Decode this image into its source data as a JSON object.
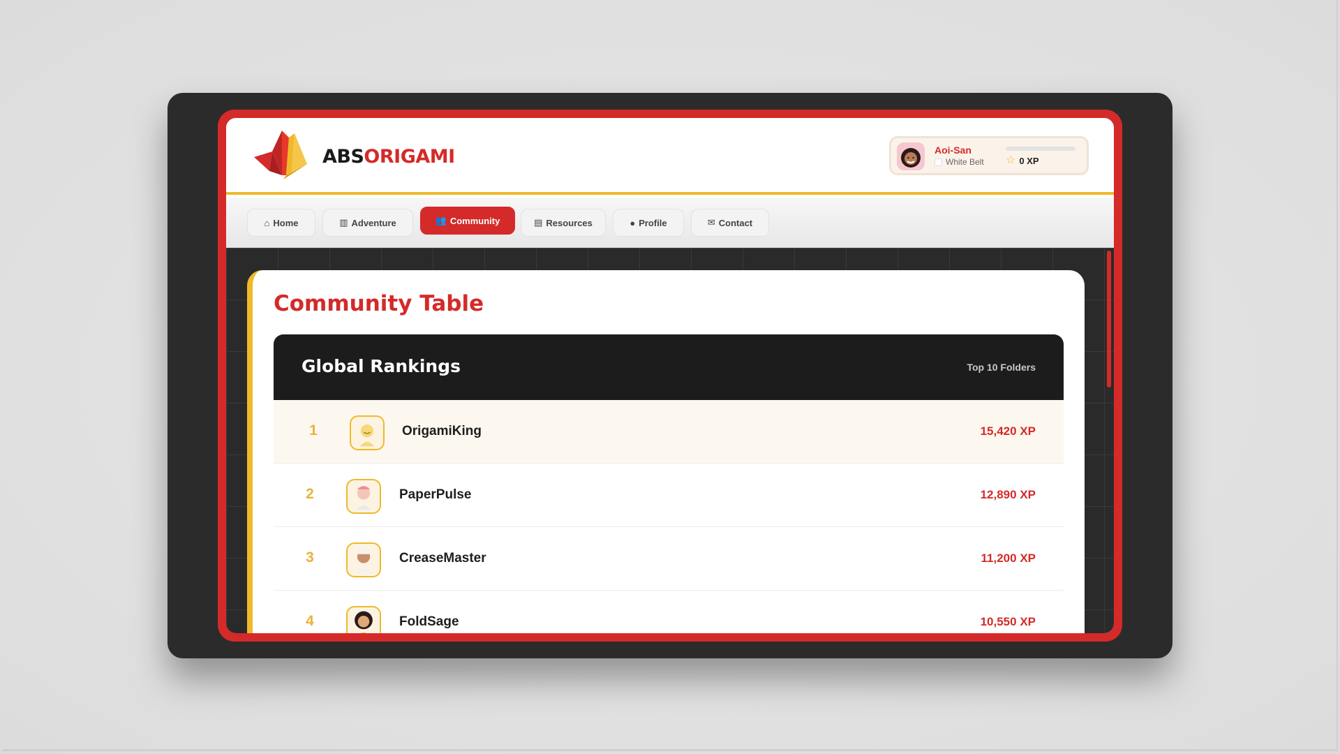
{
  "brand": {
    "part1": "ABS",
    "part2": "ORIGAMI"
  },
  "user": {
    "name": "Aoi-San",
    "belt": "White Belt",
    "xp": "0 XP",
    "xp_progress": 0
  },
  "nav": {
    "items": [
      {
        "label": "Home",
        "icon": "home-icon"
      },
      {
        "label": "Adventure",
        "icon": "map-icon"
      },
      {
        "label": "Community",
        "icon": "users-icon",
        "active": true
      },
      {
        "label": "Resources",
        "icon": "book-icon"
      },
      {
        "label": "Profile",
        "icon": "user-icon"
      },
      {
        "label": "Contact",
        "icon": "envelope-icon"
      }
    ]
  },
  "page": {
    "title": "Community Table"
  },
  "rankings": {
    "title": "Global Rankings",
    "subtitle": "Top 10 Folders",
    "rows": [
      {
        "rank": "1",
        "name": "OrigamiKing",
        "xp": "15,420 XP"
      },
      {
        "rank": "2",
        "name": "PaperPulse",
        "xp": "12,890 XP"
      },
      {
        "rank": "3",
        "name": "CreaseMaster",
        "xp": "11,200 XP"
      },
      {
        "rank": "4",
        "name": "FoldSage",
        "xp": "10,550 XP"
      }
    ]
  },
  "colors": {
    "accent": "#d42a2a",
    "gold": "#f0b92a",
    "dark": "#1c1c1c"
  }
}
